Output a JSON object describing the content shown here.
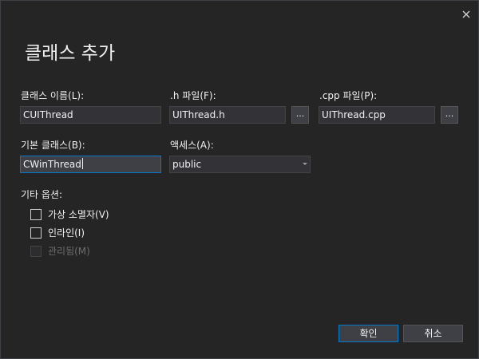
{
  "dialog": {
    "title": "클래스 추가",
    "close_icon": "close-icon"
  },
  "fields": {
    "class_name": {
      "label": "클래스 이름(L):",
      "value": "CUIThread"
    },
    "h_file": {
      "label": ".h 파일(F):",
      "value": "UIThread.h",
      "browse_label": "..."
    },
    "cpp_file": {
      "label": ".cpp 파일(P):",
      "value": "UIThread.cpp",
      "browse_label": "..."
    },
    "base_class": {
      "label": "기본 클래스(B):",
      "value": "CWinThread"
    },
    "access": {
      "label": "액세스(A):",
      "selected": "public"
    }
  },
  "options": {
    "label": "기타 옵션:",
    "items": [
      {
        "label": "가상 소멸자(V)",
        "checked": false,
        "enabled": true
      },
      {
        "label": "인라인(I)",
        "checked": false,
        "enabled": true
      },
      {
        "label": "관리됨(M)",
        "checked": false,
        "enabled": false
      }
    ]
  },
  "buttons": {
    "ok_label": "확인",
    "cancel_label": "취소"
  },
  "colors": {
    "background": "#252526",
    "field_background": "#333337",
    "focus_accent": "#007acc",
    "text": "#f1f1f1",
    "disabled_text": "#6d6d6d"
  }
}
